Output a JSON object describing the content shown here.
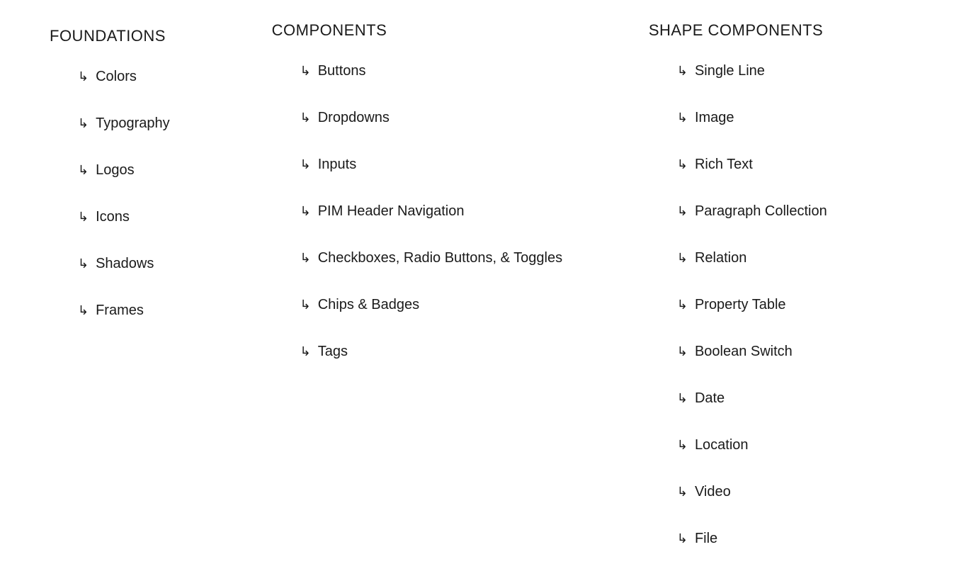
{
  "sections": [
    {
      "title": "FOUNDATIONS",
      "items": [
        "Colors",
        "Typography",
        "Logos",
        "Icons",
        "Shadows",
        "Frames"
      ]
    },
    {
      "title": "COMPONENTS",
      "items": [
        "Buttons",
        "Dropdowns",
        "Inputs",
        "PIM Header Navigation",
        "Checkboxes, Radio Buttons, & Toggles",
        "Chips & Badges",
        "Tags"
      ]
    },
    {
      "title": "SHAPE COMPONENTS",
      "items": [
        "Single Line",
        "Image",
        "Rich Text",
        "Paragraph Collection",
        "Relation",
        "Property Table",
        "Boolean Switch",
        "Date",
        "Location",
        "Video",
        "File"
      ]
    }
  ]
}
